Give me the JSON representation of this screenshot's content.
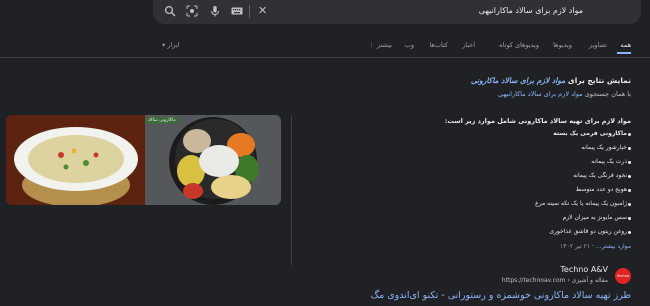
{
  "search": {
    "query": "مواد لازم برای سالاد ماکارانیهی",
    "icons": [
      "close-icon",
      "keyboard-icon",
      "mic-icon",
      "lens-icon",
      "search-icon"
    ]
  },
  "tabs": [
    "همه",
    "تصاویر",
    "ویدیوها",
    "ویدیوهای کوتاه",
    "اخبار",
    "کتاب‌ها",
    "وب",
    "بیشتر"
  ],
  "tools_label": "ابزار",
  "spelling": {
    "prefix": "نمایش نتایج برای ",
    "corrected": "مواد لازم برای سالاد ماکارونی",
    "alt_prefix": "با همان جستجوی ",
    "alt_query": "مواد لازم برای سالاد ماکارانیهی"
  },
  "snippet": {
    "title": "مواد لازم برای تهیه سالاد ماکارونی شامل موارد زیر است:",
    "items": [
      "ماکارونی فرمی یک بسته",
      "خیارشور یک پیمانه",
      "ذرت یک پیمانه",
      "نخود فرنگی یک پیمانه",
      "هویج دو عدد متوسط",
      "ژامبون یک پیمانه یا یک تکه سینه مرغ",
      "سس مایونز به میزان لازم",
      "روغن زیتون دو قاشق غذاخوری"
    ],
    "more": "موارد بیشتر...",
    "date": "۲۱ تیر ۱۴۰۲"
  },
  "image_badge": "ماکارونی سالاد",
  "result": {
    "site_name": "Techno A&V",
    "url": "https://technoav.com › مقاله و آشپزی",
    "favicon_text": "Techno",
    "title": "طرز تهیه سالاد ماکارونی خوشمزه و رستورانی - تکنو ای‌اندوی مگ"
  },
  "colors": {
    "background": "#202124",
    "link": "#8ab4f8",
    "text": "#e8eaed"
  }
}
